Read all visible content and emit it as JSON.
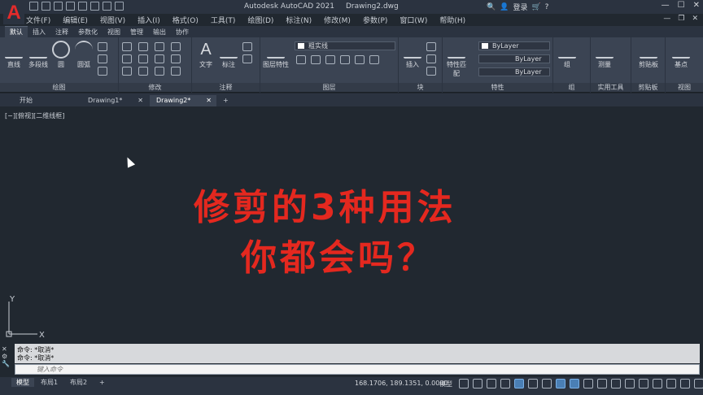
{
  "title_bar": {
    "app_name": "Autodesk AutoCAD 2021",
    "document_name": "Drawing2.dwg",
    "login_label": "登录",
    "logo_letter": "A",
    "brand_color": "#e32b2b"
  },
  "menu": {
    "items": [
      "文件(F)",
      "编辑(E)",
      "视图(V)",
      "插入(I)",
      "格式(O)",
      "工具(T)",
      "绘图(D)",
      "标注(N)",
      "修改(M)",
      "参数(P)",
      "窗口(W)",
      "帮助(H)"
    ]
  },
  "ribbon_tabs": [
    "默认",
    "插入",
    "注释",
    "参数化",
    "视图",
    "管理",
    "输出",
    "协作"
  ],
  "ribbon": {
    "draw": {
      "title": "绘图",
      "tools": [
        "直线",
        "多段线",
        "圆",
        "圆弧"
      ]
    },
    "modify": {
      "title": "修改"
    },
    "annotation": {
      "title": "注释",
      "tools": [
        "文字",
        "标注"
      ]
    },
    "layers": {
      "title": "图层",
      "tools": [
        "图层特性"
      ],
      "current_layer": "粗实线"
    },
    "block": {
      "title": "块",
      "tools": [
        "插入"
      ]
    },
    "properties": {
      "title": "特性",
      "tools": [
        "特性匹配"
      ],
      "color": "ByLayer",
      "linetype": "ByLayer",
      "lineweight": "ByLayer"
    },
    "groups": {
      "title": "组",
      "tools": [
        "组"
      ]
    },
    "utilities": {
      "title": "实用工具",
      "tools": [
        "测量"
      ]
    },
    "clipboard": {
      "title": "剪贴板",
      "tools": [
        "剪贴板"
      ]
    },
    "view": {
      "title": "视图",
      "tools": [
        "基点"
      ]
    }
  },
  "doc_tabs": [
    "开始",
    "Drawing1*",
    "Drawing2*"
  ],
  "viewport_label": "[−][俯视][二维线框]",
  "headline": {
    "line1": "修剪的3种用法",
    "line2": "你都会吗？",
    "color": "#e4281f"
  },
  "ucs": {
    "x_label": "X",
    "y_label": "Y"
  },
  "command": {
    "history": [
      "命令: *取消*",
      "命令: *取消*"
    ],
    "placeholder": "键入命令"
  },
  "layout_tabs": [
    "模型",
    "布局1",
    "布局2"
  ],
  "status": {
    "coordinates": "168.1706, 189.1351, 0.0000",
    "space": "模型"
  }
}
